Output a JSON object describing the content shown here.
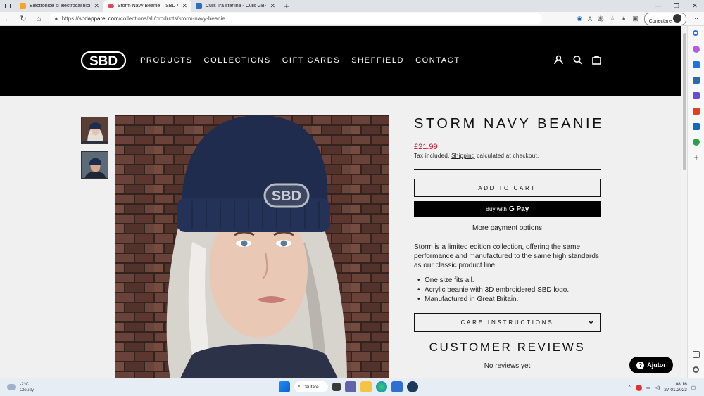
{
  "browser": {
    "tabs": [
      {
        "title": "Electronice si electrocasnice onli",
        "favicon_color": "#f5a623",
        "active": false
      },
      {
        "title": "Storm Navy Beanie – SBD Appar",
        "favicon_color": "#d94a5b",
        "active": true
      },
      {
        "title": "Curs lira sterlina - Curs GBP | Cu",
        "favicon_color": "#2c6fb7",
        "active": false
      }
    ],
    "url_scheme": "https://",
    "url_host": "sbdapparel.com",
    "url_path": "/collections/all/products/storm-navy-beanie",
    "signin_label": "Conectare"
  },
  "site": {
    "logo_text": "SBD",
    "nav": [
      "PRODUCTS",
      "COLLECTIONS",
      "GIFT CARDS",
      "SHEFFIELD",
      "CONTACT"
    ]
  },
  "product": {
    "title": "STORM NAVY BEANIE",
    "price": "£21.99",
    "tax_prefix": "Tax included.",
    "tax_link": "Shipping",
    "tax_suffix": "calculated at checkout.",
    "add_to_cart": "ADD TO CART",
    "buy_with": "Buy with",
    "pay_brand": "G Pay",
    "more_payment": "More payment options",
    "description": "Storm is a limited edition collection, offering the same performance and manufactured to the same high standards as our classic product line.",
    "bullets": [
      "One size fits all.",
      "Acrylic beanie with 3D embroidered SBD logo.",
      "Manufactured in Great Britain."
    ],
    "care_label": "CARE INSTRUCTIONS",
    "reviews_title": "CUSTOMER REVIEWS",
    "reviews_empty": "No reviews yet",
    "beanie_logo": "SBD"
  },
  "help": {
    "label": "Ajutor"
  },
  "taskbar": {
    "temperature": "-2°C",
    "weather": "Cloudy",
    "search_label": "Căutare",
    "time": "08:16",
    "date": "27.01.2023"
  },
  "colors": {
    "price": "#c8102e",
    "header_bg": "#000000",
    "beanie": "#1f2c4d"
  }
}
